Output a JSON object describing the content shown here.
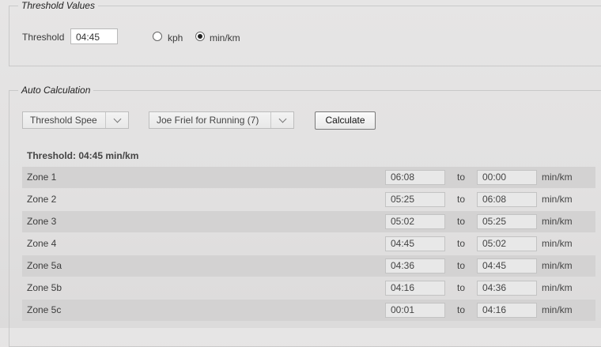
{
  "threshold_section": {
    "legend": "Threshold Values",
    "threshold_label": "Threshold",
    "threshold_value": "04:45",
    "unit_options": [
      {
        "label": "kph",
        "selected": false
      },
      {
        "label": "min/km",
        "selected": true
      }
    ]
  },
  "auto_section": {
    "legend": "Auto Calculation",
    "metric_select": "Threshold Spee",
    "method_select": "Joe Friel for Running (7)",
    "calculate_label": "Calculate",
    "threshold_display": "Threshold: 04:45 min/km",
    "to_label": "to",
    "unit_label": "min/km",
    "zones": [
      {
        "name": "Zone 1",
        "from": "06:08",
        "to": "00:00"
      },
      {
        "name": "Zone 2",
        "from": "05:25",
        "to": "06:08"
      },
      {
        "name": "Zone 3",
        "from": "05:02",
        "to": "05:25"
      },
      {
        "name": "Zone 4",
        "from": "04:45",
        "to": "05:02"
      },
      {
        "name": "Zone 5a",
        "from": "04:36",
        "to": "04:45"
      },
      {
        "name": "Zone 5b",
        "from": "04:16",
        "to": "04:36"
      },
      {
        "name": "Zone 5c",
        "from": "00:01",
        "to": "04:16"
      }
    ]
  }
}
